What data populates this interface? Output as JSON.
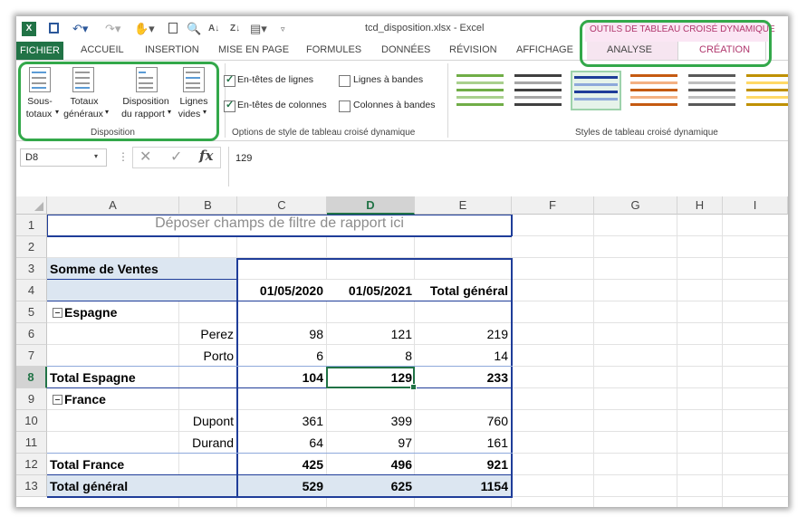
{
  "window": {
    "doc_title": "tcd_disposition.xlsx - Excel"
  },
  "context_title": "OUTILS DE TABLEAU CROISÉ DYNAMIQUE",
  "tabs": [
    "FICHIER",
    "ACCUEIL",
    "INSERTION",
    "MISE EN PAGE",
    "FORMULES",
    "DONNÉES",
    "RÉVISION",
    "AFFICHAGE",
    "ANALYSE",
    "CRÉATION"
  ],
  "ribbon": {
    "disposition": {
      "buttons": [
        {
          "line1": "Sous-",
          "line2": "totaux"
        },
        {
          "line1": "Totaux",
          "line2": "généraux"
        },
        {
          "line1": "Disposition",
          "line2": "du rapport"
        },
        {
          "line1": "Lignes",
          "line2": "vides"
        }
      ],
      "label": "Disposition"
    },
    "options": {
      "checkboxes": [
        {
          "label": "En-têtes de lignes",
          "checked": true
        },
        {
          "label": "Lignes à bandes",
          "checked": false
        },
        {
          "label": "En-têtes de colonnes",
          "checked": true
        },
        {
          "label": "Colonnes à bandes",
          "checked": false
        }
      ],
      "label": "Options de style de tableau croisé dynamique"
    },
    "styles": {
      "label": "Styles de tableau croisé dynamique"
    }
  },
  "formula_bar": {
    "name_box": "D8",
    "value": "129",
    "fx": "fx"
  },
  "columns": [
    "A",
    "B",
    "C",
    "D",
    "E",
    "F",
    "G",
    "H",
    "I"
  ],
  "rows": [
    "1",
    "2",
    "3",
    "4",
    "5",
    "6",
    "7",
    "8",
    "9",
    "10",
    "11",
    "12",
    "13"
  ],
  "pivot": {
    "filter_placeholder": "Déposer champs de filtre de rapport ici",
    "value_label": "Somme de Ventes",
    "col_headers": [
      "01/05/2020",
      "01/05/2021",
      "Total général"
    ],
    "groups": [
      {
        "name": "Espagne",
        "items": [
          {
            "name": "Perez",
            "v": [
              "98",
              "121",
              "219"
            ]
          },
          {
            "name": "Porto",
            "v": [
              "6",
              "8",
              "14"
            ]
          }
        ],
        "total_label": "Total Espagne",
        "total": [
          "104",
          "129",
          "233"
        ]
      },
      {
        "name": "France",
        "items": [
          {
            "name": "Dupont",
            "v": [
              "361",
              "399",
              "760"
            ]
          },
          {
            "name": "Durand",
            "v": [
              "64",
              "97",
              "161"
            ]
          }
        ],
        "total_label": "Total France",
        "total": [
          "425",
          "496",
          "921"
        ]
      }
    ],
    "grand_total_label": "Total général",
    "grand_total": [
      "529",
      "625",
      "1154"
    ],
    "collapse_icon": "minus-box-icon"
  },
  "colors": {
    "excel_green": "#217346",
    "context_pink": "#b0366d",
    "pivot_blue": "#1f3d99",
    "highlight_green": "#33a84a"
  }
}
